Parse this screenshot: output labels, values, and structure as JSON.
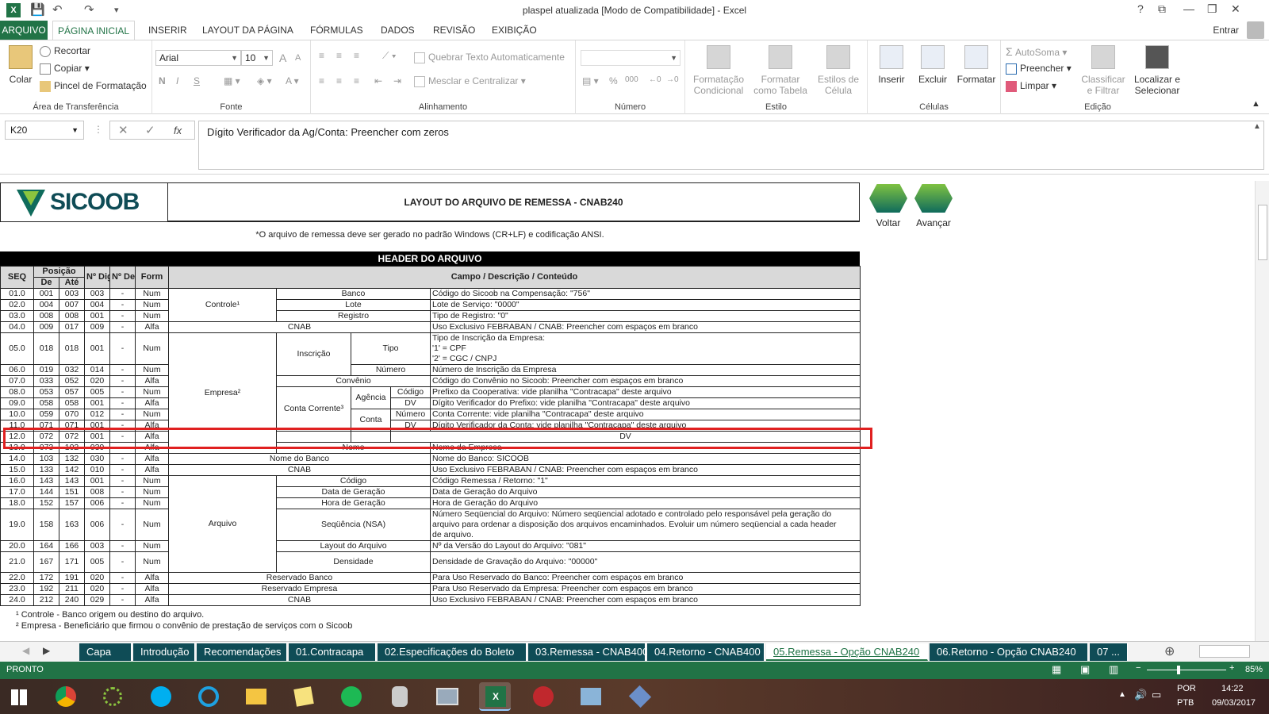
{
  "window": {
    "title": "plaspel atualizada  [Modo de Compatibilidade] - Excel",
    "controls": [
      "?",
      "⧉",
      "—",
      "❐",
      "✕"
    ]
  },
  "ribbon_tabs": {
    "file": "ARQUIVO",
    "tabs": [
      "PÁGINA INICIAL",
      "INSERIR",
      "LAYOUT DA PÁGINA",
      "FÓRMULAS",
      "DADOS",
      "REVISÃO",
      "EXIBIÇÃO"
    ],
    "active": "PÁGINA INICIAL",
    "signin": "Entrar"
  },
  "ribbon": {
    "clipboard": {
      "label": "Área de Transferência",
      "paste": "Colar",
      "cut": "Recortar",
      "copy": "Copiar",
      "format_painter": "Pincel de Formatação"
    },
    "font": {
      "label": "Fonte",
      "name": "Arial",
      "size": "10",
      "bold": "N",
      "italic": "I",
      "underline": "S",
      "grow": "A",
      "shrink": "A",
      "color": "A"
    },
    "alignment": {
      "label": "Alinhamento",
      "wrap": "Quebrar Texto Automaticamente",
      "merge": "Mesclar e Centralizar"
    },
    "number": {
      "label": "Número",
      "format": "",
      "percent": "%",
      "thousands": "000"
    },
    "styles": {
      "label": "Estilo",
      "conditional": "Formatação Condicional",
      "table": "Formatar como Tabela",
      "cell": "Estilos de Célula"
    },
    "cells": {
      "label": "Células",
      "insert": "Inserir",
      "delete": "Excluir",
      "format": "Formatar"
    },
    "editing": {
      "label": "Edição",
      "autosum": "AutoSoma",
      "fill": "Preencher",
      "clear": "Limpar",
      "sort": "Classificar e Filtrar",
      "find": "Localizar e Selecionar"
    }
  },
  "formula_bar": {
    "cell": "K20",
    "content": "Dígito Verificador da Ag/Conta: Preencher com zeros",
    "fx": "fx"
  },
  "sheet": {
    "logo_text": "SICOOB",
    "layout_title": "LAYOUT DO ARQUIVO DE REMESSA - CNAB240",
    "note": "*O arquivo de remessa deve ser gerado no padrão Windows (CR+LF) e codificação ANSI.",
    "nav_back": "Voltar",
    "nav_next": "Avançar",
    "header_bar": "HEADER DO ARQUIVO",
    "headers": {
      "seq": "SEQ",
      "posicao": "Posição",
      "de": "De",
      "ate": "Até",
      "ndig": "Nº Dig",
      "ndec": "Nº Dec",
      "form": "Form",
      "campo": "Campo / Descrição / Conteúdo"
    },
    "groups": {
      "controle": "Controle¹",
      "empresa": "Empresa²",
      "arquivo": "Arquivo",
      "inscricao": "Inscrição",
      "conta_corrente": "Conta Corrente³",
      "agencia": "Agência",
      "conta": "Conta"
    },
    "rows": [
      {
        "seq": "01.0",
        "de": "001",
        "ate": "003",
        "dig": "003",
        "dec": "-",
        "form": "Num",
        "sub": "Banco",
        "desc": "Código do Sicoob na Compensação: \"756\""
      },
      {
        "seq": "02.0",
        "de": "004",
        "ate": "007",
        "dig": "004",
        "dec": "-",
        "form": "Num",
        "sub": "Lote",
        "desc": "Lote de Serviço: \"0000\""
      },
      {
        "seq": "03.0",
        "de": "008",
        "ate": "008",
        "dig": "001",
        "dec": "-",
        "form": "Num",
        "sub": "Registro",
        "desc": "Tipo de Registro: \"0\""
      },
      {
        "seq": "04.0",
        "de": "009",
        "ate": "017",
        "dig": "009",
        "dec": "-",
        "form": "Alfa",
        "sub": "CNAB",
        "desc": "Uso Exclusivo FEBRABAN / CNAB: Preencher com espaços em branco"
      },
      {
        "seq": "05.0",
        "de": "018",
        "ate": "018",
        "dig": "001",
        "dec": "-",
        "form": "Num",
        "sub": "Tipo",
        "desc1": "Tipo de Inscrição da Empresa:",
        "desc2": "'1'  =  CPF",
        "desc3": "'2'  =  CGC / CNPJ"
      },
      {
        "seq": "06.0",
        "de": "019",
        "ate": "032",
        "dig": "014",
        "dec": "-",
        "form": "Num",
        "sub": "Número",
        "desc": "Número de Inscrição da Empresa"
      },
      {
        "seq": "07.0",
        "de": "033",
        "ate": "052",
        "dig": "020",
        "dec": "-",
        "form": "Alfa",
        "sub": "Convênio",
        "desc": "Código do Convênio no Sicoob: Preencher com espaços em branco"
      },
      {
        "seq": "08.0",
        "de": "053",
        "ate": "057",
        "dig": "005",
        "dec": "-",
        "form": "Num",
        "sub": "Código",
        "desc": "Prefixo da Cooperativa: vide planilha \"Contracapa\" deste arquivo"
      },
      {
        "seq": "09.0",
        "de": "058",
        "ate": "058",
        "dig": "001",
        "dec": "-",
        "form": "Alfa",
        "sub": "DV",
        "desc": "Dígito Verificador do Prefixo: vide planilha \"Contracapa\" deste arquivo"
      },
      {
        "seq": "10.0",
        "de": "059",
        "ate": "070",
        "dig": "012",
        "dec": "-",
        "form": "Num",
        "sub": "Número",
        "desc": "Conta Corrente: vide planilha \"Contracapa\" deste arquivo"
      },
      {
        "seq": "11.0",
        "de": "071",
        "ate": "071",
        "dig": "001",
        "dec": "-",
        "form": "Alfa",
        "sub": "DV",
        "desc": "Dígito Verificador da Conta: vide planilha \"Contracapa\" deste arquivo"
      },
      {
        "seq": "12.0",
        "de": "072",
        "ate": "072",
        "dig": "001",
        "dec": "-",
        "form": "Alfa",
        "sub": "DV",
        "desc": "Dígito Verificador da Ag/Conta: Preencher com zeros"
      },
      {
        "seq": "13.0",
        "de": "073",
        "ate": "102",
        "dig": "030",
        "dec": "-",
        "form": "Alfa",
        "sub": "Nome",
        "desc": "Nome da Empresa"
      },
      {
        "seq": "14.0",
        "de": "103",
        "ate": "132",
        "dig": "030",
        "dec": "-",
        "form": "Alfa",
        "sub": "Nome do Banco",
        "desc": "Nome do Banco: SICOOB"
      },
      {
        "seq": "15.0",
        "de": "133",
        "ate": "142",
        "dig": "010",
        "dec": "-",
        "form": "Alfa",
        "sub": "CNAB",
        "desc": "Uso Exclusivo FEBRABAN / CNAB: Preencher com espaços em branco"
      },
      {
        "seq": "16.0",
        "de": "143",
        "ate": "143",
        "dig": "001",
        "dec": "-",
        "form": "Num",
        "sub": "Código",
        "desc": "Código Remessa / Retorno: \"1\""
      },
      {
        "seq": "17.0",
        "de": "144",
        "ate": "151",
        "dig": "008",
        "dec": "-",
        "form": "Num",
        "sub": "Data de Geração",
        "desc": "Data de Geração do Arquivo"
      },
      {
        "seq": "18.0",
        "de": "152",
        "ate": "157",
        "dig": "006",
        "dec": "-",
        "form": "Num",
        "sub": "Hora de Geração",
        "desc": "Hora de Geração do Arquivo"
      },
      {
        "seq": "19.0",
        "de": "158",
        "ate": "163",
        "dig": "006",
        "dec": "-",
        "form": "Num",
        "sub": "Seqüência (NSA)",
        "desc1": "Número Seqüencial do Arquivo: Número seqüencial adotado e controlado pelo responsável pela geração do",
        "desc2": "arquivo para ordenar a disposição dos arquivos encaminhados. Evoluir um número seqüencial a cada header",
        "desc3": "de arquivo."
      },
      {
        "seq": "20.0",
        "de": "164",
        "ate": "166",
        "dig": "003",
        "dec": "-",
        "form": "Num",
        "sub": "Layout do Arquivo",
        "desc": "Nº da Versão do Layout do Arquivo: \"081\""
      },
      {
        "seq": "21.0",
        "de": "167",
        "ate": "171",
        "dig": "005",
        "dec": "-",
        "form": "Num",
        "sub": "Densidade",
        "desc": "Densidade de Gravação do Arquivo: \"00000\""
      },
      {
        "seq": "22.0",
        "de": "172",
        "ate": "191",
        "dig": "020",
        "dec": "-",
        "form": "Alfa",
        "sub": "Reservado Banco",
        "desc": "Para Uso Reservado do Banco: Preencher com espaços em branco"
      },
      {
        "seq": "23.0",
        "de": "192",
        "ate": "211",
        "dig": "020",
        "dec": "-",
        "form": "Alfa",
        "sub": "Reservado Empresa",
        "desc": "Para Uso Reservado da Empresa: Preencher com espaços em branco"
      },
      {
        "seq": "24.0",
        "de": "212",
        "ate": "240",
        "dig": "029",
        "dec": "-",
        "form": "Alfa",
        "sub": "CNAB",
        "desc": "Uso Exclusivo FEBRABAN / CNAB: Preencher com espaços em branco"
      }
    ],
    "footnotes": [
      "¹  Controle - Banco origem ou destino do arquivo.",
      "²  Empresa - Beneficiário que firmou o convênio de prestação de serviços com o Sicoob"
    ]
  },
  "sheet_tabs": [
    "Capa",
    "Introdução",
    "Recomendações",
    "01.Contracapa",
    "02.Especificações do Boleto",
    "03.Remessa - CNAB400",
    "04.Retorno - CNAB400",
    "05.Remessa - Opção CNAB240",
    "06.Retorno - Opção CNAB240",
    "07 ..."
  ],
  "active_sheet": "05.Remessa - Opção CNAB240",
  "status": {
    "mode": "PRONTO",
    "zoom": "85%"
  },
  "taskbar": {
    "lang1": "POR",
    "lang2": "PTB",
    "time": "14:22",
    "date": "09/03/2017"
  }
}
